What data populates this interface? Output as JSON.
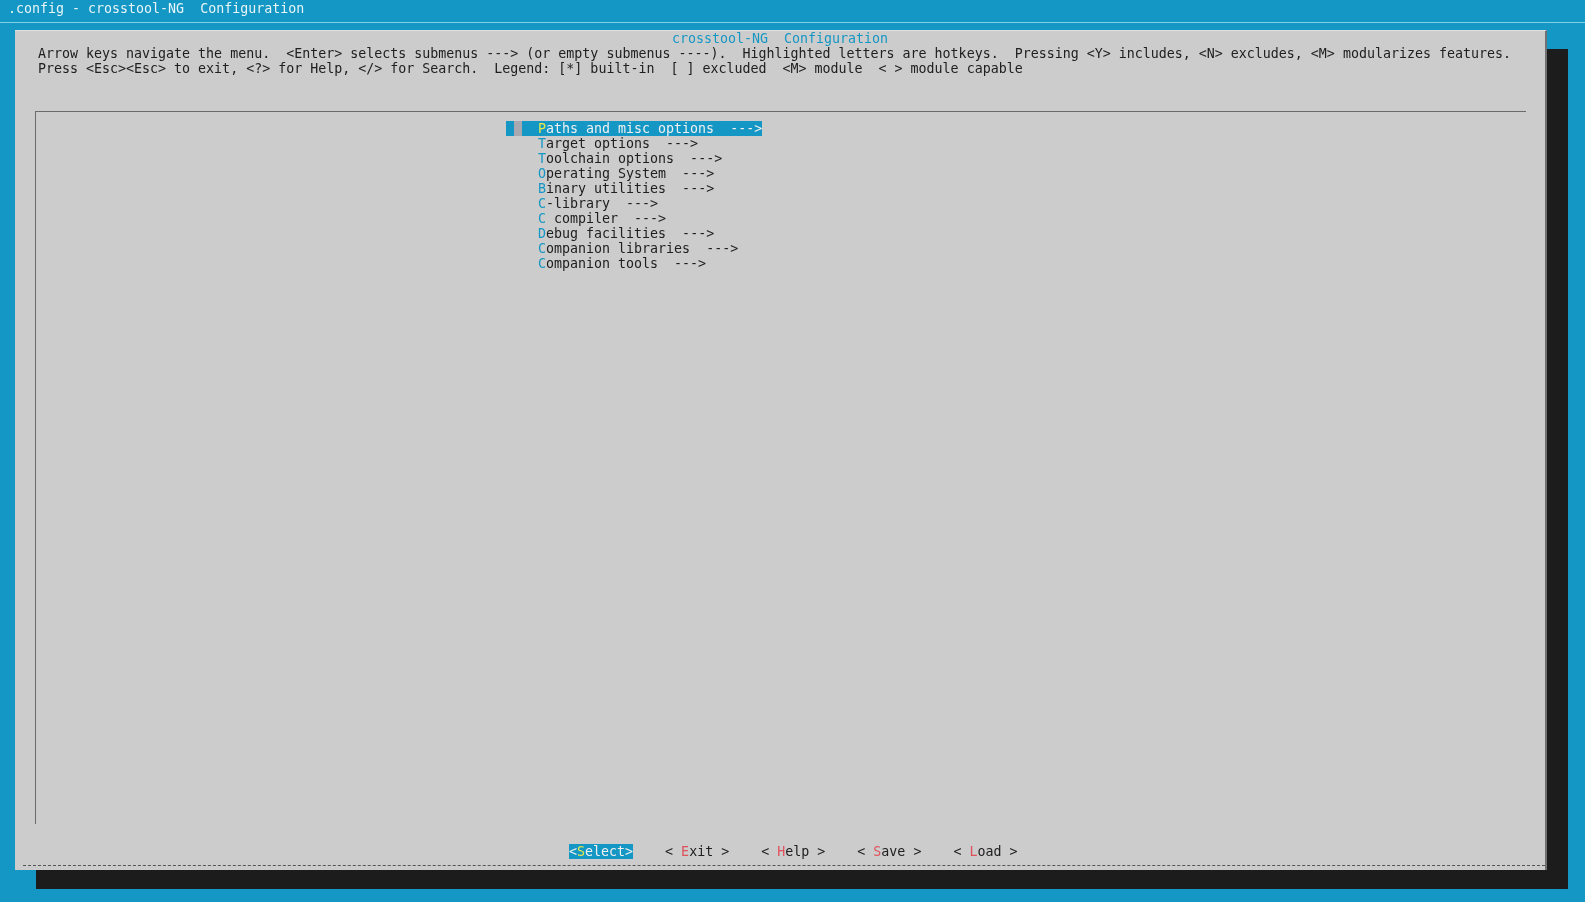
{
  "window": {
    "title": ".config - crosstool-NG  Configuration"
  },
  "dialog": {
    "title": "crosstool-NG  Configuration",
    "help_lines": [
      "Arrow keys navigate the menu.  <Enter> selects submenus ---> (or empty submenus ----).  Highlighted letters are hotkeys.  Pressing <Y> includes, <N> excludes, <M> modularizes features.",
      "Press <Esc><Esc> to exit, <?> for Help, </> for Search.  Legend: [*] built-in  [ ] excluded  <M> module  < > module capable"
    ]
  },
  "menu": {
    "items": [
      {
        "label": "Paths and misc options",
        "arrow": "--->",
        "selected": true
      },
      {
        "label": "Target options",
        "arrow": "--->",
        "selected": false
      },
      {
        "label": "Toolchain options",
        "arrow": "--->",
        "selected": false
      },
      {
        "label": "Operating System",
        "arrow": "--->",
        "selected": false
      },
      {
        "label": "Binary utilities",
        "arrow": "--->",
        "selected": false
      },
      {
        "label": "C-library",
        "arrow": "--->",
        "selected": false
      },
      {
        "label": "C compiler",
        "arrow": "--->",
        "selected": false
      },
      {
        "label": "Debug facilities",
        "arrow": "--->",
        "selected": false
      },
      {
        "label": "Companion libraries",
        "arrow": "--->",
        "selected": false
      },
      {
        "label": "Companion tools",
        "arrow": "--->",
        "selected": false
      }
    ]
  },
  "buttons": [
    {
      "label": "Select",
      "left": "<",
      "right": ">",
      "selected": true
    },
    {
      "label": "Exit",
      "left": "<",
      "right": ">",
      "selected": false
    },
    {
      "label": "Help",
      "left": "<",
      "right": ">",
      "selected": false
    },
    {
      "label": "Save",
      "left": "<",
      "right": ">",
      "selected": false
    },
    {
      "label": "Load",
      "left": "<",
      "right": ">",
      "selected": false
    }
  ]
}
